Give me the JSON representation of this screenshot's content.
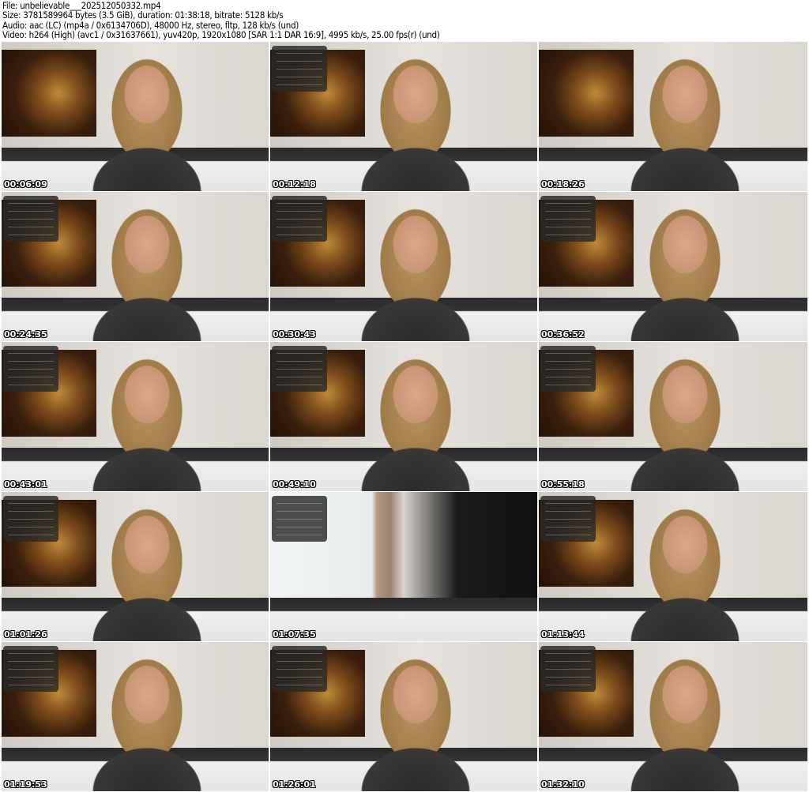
{
  "header": {
    "file": "File: unbelievable___202512050332.mp4",
    "size": "Size: 3781589964 bytes (3.5 GiB), duration: 01:38:18, bitrate: 5128 kb/s",
    "audio": "Audio: aac (LC) (mp4a / 0x6134706D), 48000 Hz, stereo, fltp, 128 kb/s (und)",
    "video": "Video: h264 (High) (avc1 / 0x31637661), yuv420p, 1920x1080 [SAR 1:1 DAR 16:9], 4995 kb/s, 25.00 fps(r) (und)"
  },
  "thumbnails": [
    {
      "timestamp": "00:06:09"
    },
    {
      "timestamp": "00:12:18"
    },
    {
      "timestamp": "00:18:26"
    },
    {
      "timestamp": "00:24:35"
    },
    {
      "timestamp": "00:30:43"
    },
    {
      "timestamp": "00:36:52"
    },
    {
      "timestamp": "00:43:01"
    },
    {
      "timestamp": "00:49:10"
    },
    {
      "timestamp": "00:55:18"
    },
    {
      "timestamp": "01:01:26"
    },
    {
      "timestamp": "01:07:35"
    },
    {
      "timestamp": "01:13:44"
    },
    {
      "timestamp": "01:19:53"
    },
    {
      "timestamp": "01:26:01"
    },
    {
      "timestamp": "01:32:10"
    }
  ]
}
